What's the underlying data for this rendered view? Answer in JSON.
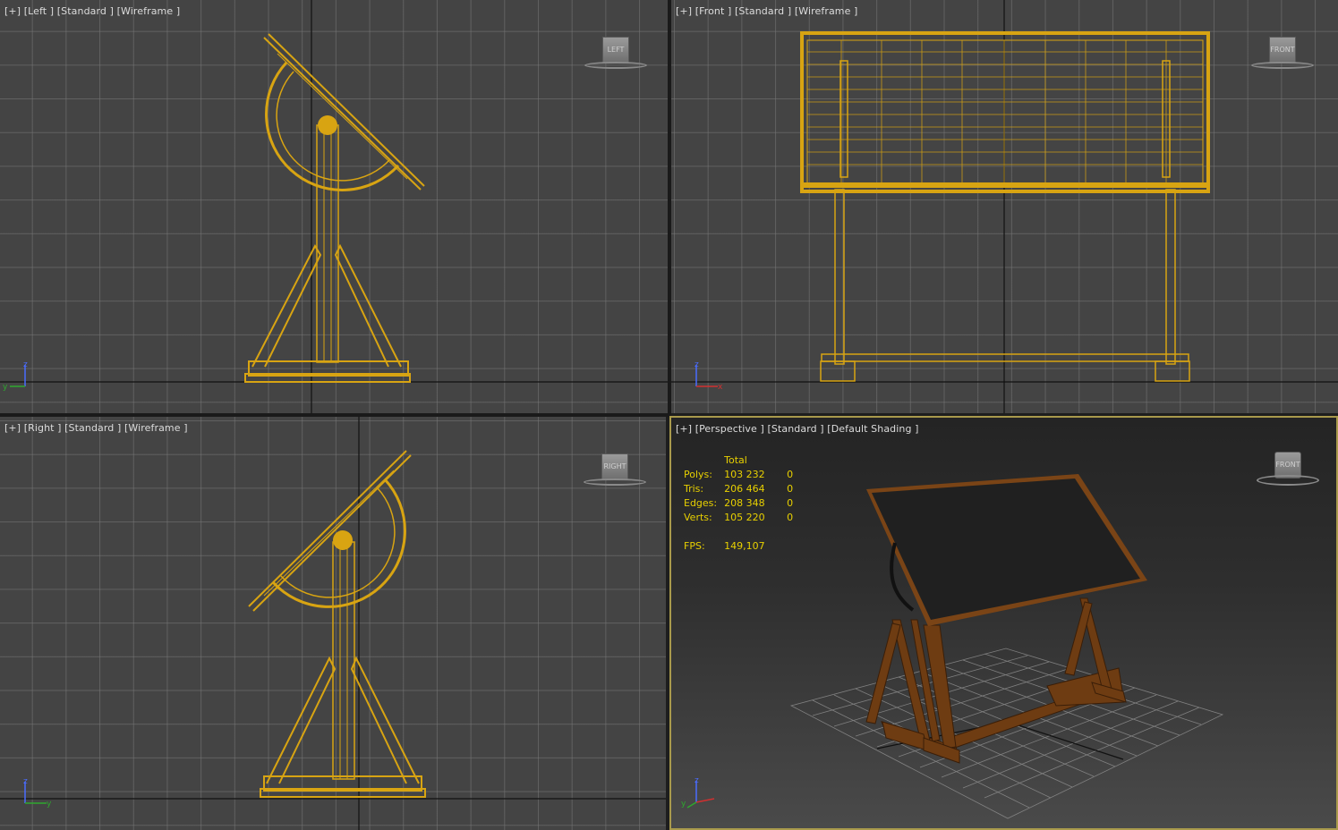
{
  "viewports": {
    "left": {
      "label": "[+] [Left ] [Standard ] [Wireframe ]",
      "cube_label": "LEFT"
    },
    "front": {
      "label": "[+] [Front ] [Standard ] [Wireframe ]",
      "cube_label": "FRONT"
    },
    "right": {
      "label": "[+] [Right ] [Standard ] [Wireframe ]",
      "cube_label": "RIGHT"
    },
    "perspective": {
      "label": "[+] [Perspective ] [Standard ] [Default Shading ]",
      "cube_label": "FRONT"
    }
  },
  "stats": {
    "header": "Total",
    "rows": [
      {
        "label": "Polys:",
        "total": "103 232",
        "selected": "0"
      },
      {
        "label": "Tris:",
        "total": "206 464",
        "selected": "0"
      },
      {
        "label": "Edges:",
        "total": "208 348",
        "selected": "0"
      },
      {
        "label": "Verts:",
        "total": "105 220",
        "selected": "0"
      }
    ],
    "fps_label": "FPS:",
    "fps_value": "149,107"
  },
  "axis_labels": {
    "z": "z",
    "y": "y",
    "x": "x"
  },
  "colors": {
    "wire": "#d8a412",
    "wire_dark": "#a87e0a",
    "viewport_bg": "#444444",
    "active_border": "#a99a4c",
    "stats_text": "#e8d000",
    "wood": "#7a4416",
    "board": "#202020"
  }
}
